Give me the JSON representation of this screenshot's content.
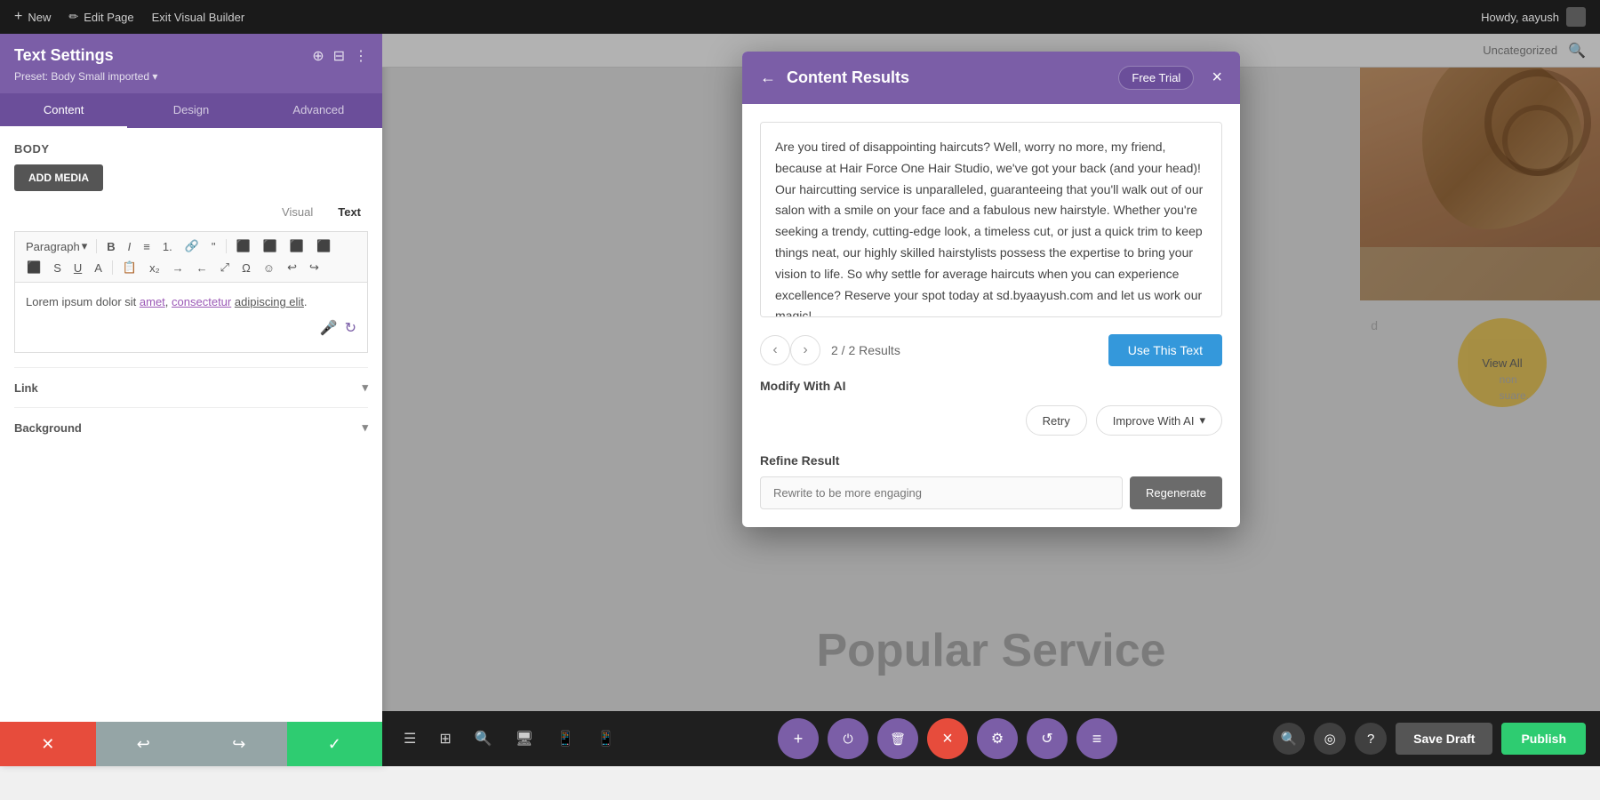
{
  "topbar": {
    "new_label": "New",
    "edit_page_label": "Edit Page",
    "exit_builder_label": "Exit Visual Builder",
    "howdy_text": "Howdy, aayush"
  },
  "admin_bar": {
    "uncategorized": "Uncategorized"
  },
  "text_settings": {
    "title": "Text Settings",
    "preset": "Preset: Body Small imported ▾",
    "tabs": [
      "Content",
      "Design",
      "Advanced"
    ],
    "active_tab": "Content",
    "body_label": "Body",
    "add_media": "ADD MEDIA",
    "visual_label": "Visual",
    "text_label": "Text",
    "paragraph_label": "Paragraph",
    "editor_content": "Lorem ipsum dolor sit amet, consectetur adipiscing elit.",
    "link_label": "Link",
    "background_label": "Background"
  },
  "modal": {
    "title": "Content Results",
    "free_trial": "Free Trial",
    "close": "×",
    "back_arrow": "←",
    "content_text": "Are you tired of disappointing haircuts? Well, worry no more, my friend, because at Hair Force One Hair Studio, we've got your back (and your head)! Our haircutting service is unparalleled, guaranteeing that you'll walk out of our salon with a smile on your face and a fabulous new hairstyle. Whether you're seeking a trendy, cutting-edge look, a timeless cut, or just a quick trim to keep things neat, our highly skilled hairstylists possess the expertise to bring your vision to life. So why settle for average haircuts when you can experience excellence? Reserve your spot today at sd.byaayush.com and let us work our magic!",
    "prev_arrow": "‹",
    "next_arrow": "›",
    "results_count": "2 / 2 Results",
    "use_text_btn": "Use This Text",
    "modify_ai_label": "Modify With AI",
    "retry_btn": "Retry",
    "improve_btn": "Improve With AI",
    "improve_chevron": "▾",
    "refine_label": "Refine Result",
    "refine_placeholder": "Rewrite to be more engaging",
    "regenerate_btn": "Regenerate"
  },
  "page": {
    "section_title": "Popular Service",
    "view_all": "View All"
  },
  "bottom_toolbar": {
    "add_icon": "+",
    "power_icon": "⏻",
    "trash_icon": "🗑",
    "close_icon": "×",
    "settings_icon": "⚙",
    "history_icon": "↺",
    "equalizer_icon": "≡",
    "save_draft": "Save Draft",
    "publish": "Publish"
  },
  "colors": {
    "purple": "#7b5ea7",
    "purple_dark": "#6b4e9a",
    "green": "#2ecc71",
    "red": "#e74c3c",
    "blue": "#3498db",
    "gray": "#95a5a6"
  }
}
